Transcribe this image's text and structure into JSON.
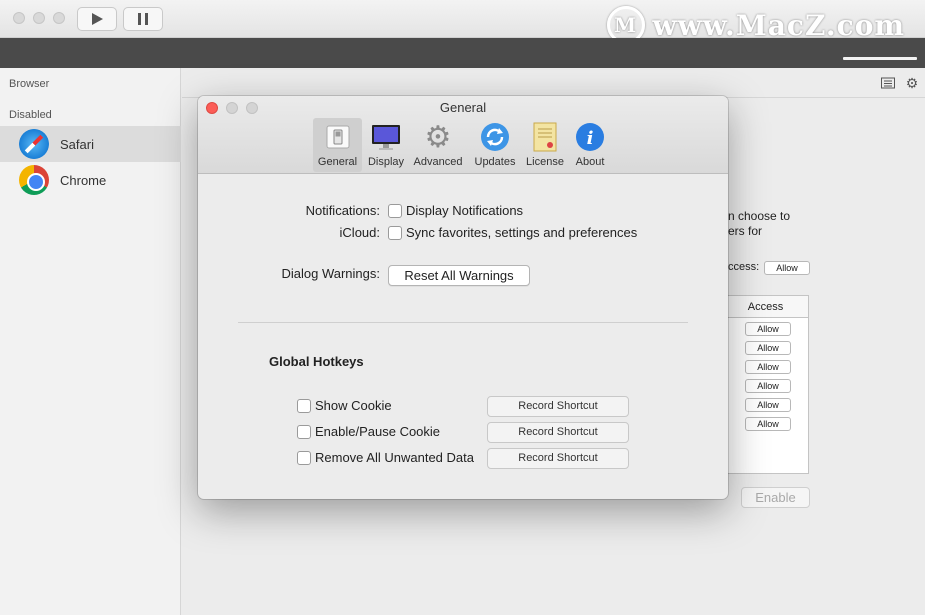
{
  "watermark": {
    "text": "www.MacZ.com",
    "logo_letter": "M"
  },
  "sidebar": {
    "section_browser": "Browser",
    "section_disabled": "Disabled",
    "items": [
      {
        "label": "Safari",
        "icon": "safari-icon",
        "selected": true
      },
      {
        "label": "Chrome",
        "icon": "chrome-icon",
        "selected": false
      }
    ]
  },
  "background": {
    "partial_text_1": "n choose to",
    "partial_text_2": "ers for",
    "partial_text_3": "ccess:",
    "allow_top": "Allow",
    "table_header": "Access",
    "allow_rows": [
      "Allow",
      "Allow",
      "Allow",
      "Allow",
      "Allow",
      "Allow"
    ],
    "enable_button": "Enable"
  },
  "dialog": {
    "title": "General",
    "tabs": [
      {
        "label": "General",
        "icon": "switch-icon",
        "active": true
      },
      {
        "label": "Display",
        "icon": "monitor-icon",
        "active": false
      },
      {
        "label": "Advanced",
        "icon": "gear-icon",
        "active": false
      },
      {
        "label": "Updates",
        "icon": "sync-icon",
        "active": false
      },
      {
        "label": "License",
        "icon": "certificate-icon",
        "active": false
      },
      {
        "label": "About",
        "icon": "info-icon",
        "active": false
      }
    ],
    "notifications_label": "Notifications:",
    "notifications_checkbox": "Display Notifications",
    "icloud_label": "iCloud:",
    "icloud_checkbox": "Sync favorites, settings and preferences",
    "dialog_warnings_label": "Dialog Warnings:",
    "reset_button": "Reset All Warnings",
    "hotkeys_title": "Global Hotkeys",
    "hotkeys": [
      {
        "label": "Show Cookie",
        "button": "Record Shortcut"
      },
      {
        "label": "Enable/Pause Cookie",
        "button": "Record Shortcut"
      },
      {
        "label": "Remove All Unwanted Data",
        "button": "Record Shortcut"
      }
    ]
  },
  "colors": {
    "close": "#fc5d57",
    "inactive_traffic": "#d9d9d9",
    "info_blue": "#2a7de1",
    "dark_bar": "#4a4a4a"
  }
}
